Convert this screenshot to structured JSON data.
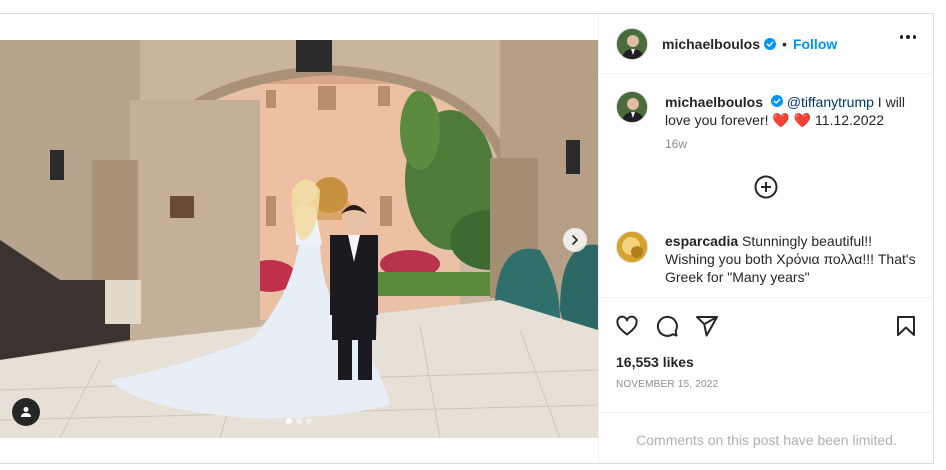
{
  "post": {
    "author": "michaelboulos",
    "follow_label": "Follow",
    "separator": "•",
    "caption": {
      "username": "michaelboulos",
      "mention": "@tiffanytrump",
      "text": " I will love you forever! ",
      "hearts": "❤️ ❤️",
      "date_text": " 11.12.2022",
      "time_ago": "16w"
    },
    "comment": {
      "username": "esparcadia",
      "text": " Stunningly beautiful!! Wishing you both Χρόνια πολλα!!! That's Greek for \"Many years\""
    },
    "likes": "16,553 likes",
    "date": "NOVEMBER 15, 2022",
    "comments_limited": "Comments on this post have been limited."
  },
  "icons": {
    "verified": "verified-badge-icon",
    "more": "more-options-icon",
    "load_more": "plus-circle-icon",
    "like": "heart-outline-icon",
    "comment": "comment-bubble-icon",
    "share": "paper-plane-icon",
    "save": "bookmark-icon",
    "next": "chevron-right-icon",
    "tag": "user-tag-icon"
  },
  "colors": {
    "accent": "#0095f6",
    "verified": "#0095f6",
    "heart": "#e0245e",
    "muted": "#8e8e8e"
  }
}
